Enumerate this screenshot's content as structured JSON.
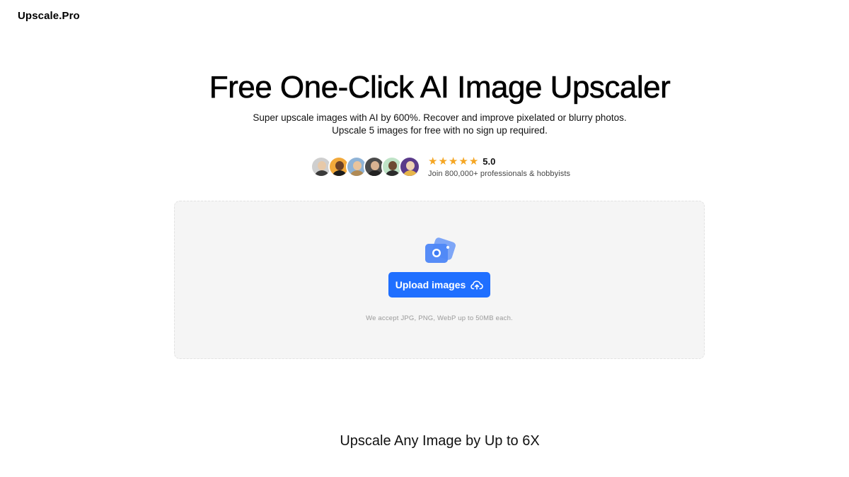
{
  "header": {
    "logo": "Upscale.Pro"
  },
  "hero": {
    "title": "Free One-Click AI Image Upscaler",
    "subtitle_line1": "Super upscale images with AI by 600%. Recover and improve pixelated or blurry photos.",
    "subtitle_line2": "Upscale 5 images for free with no sign up required."
  },
  "social_proof": {
    "avatar_count": 6,
    "stars": 5,
    "rating": "5.0",
    "caption": "Join 800,000+ professionals & hobbyists"
  },
  "upload": {
    "button_label": "Upload images",
    "button_icon": "cloud-upload-icon",
    "graphic_icon": "image-upload-icon",
    "accept_text": "We accept JPG, PNG, WebP up to 50MB each."
  },
  "section": {
    "title": "Upscale Any Image by Up to 6X"
  },
  "colors": {
    "accent": "#1f6fff",
    "star": "#f5a623",
    "dropzone_bg": "#f5f5f5"
  }
}
